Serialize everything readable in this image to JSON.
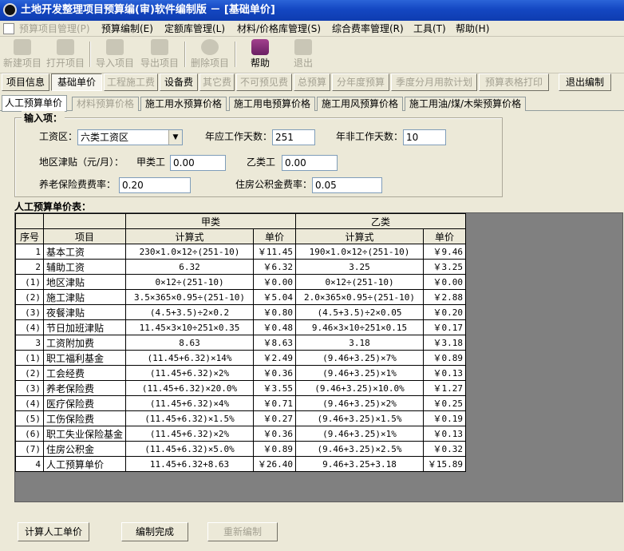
{
  "window": {
    "title": "土地开发整理项目预算编(审)软件编制版 － [基础单价]"
  },
  "menu": [
    {
      "label": "预算项目管理(P)",
      "disabled": true
    },
    {
      "label": "预算编制(E)"
    },
    {
      "label": "定额库管理(L)"
    },
    {
      "label": "材料/价格库管理(S)"
    },
    {
      "label": "综合费率管理(R)"
    },
    {
      "label": "工具(T)"
    },
    {
      "label": "帮助(H)"
    }
  ],
  "toolbar": [
    {
      "label": "新建项目",
      "icon": "new-project-icon",
      "enabled": false
    },
    {
      "label": "打开项目",
      "icon": "open-folder-icon",
      "enabled": false
    },
    {
      "label": "导入项目",
      "icon": "import-icon",
      "enabled": false
    },
    {
      "label": "导出项目",
      "icon": "export-icon",
      "enabled": false
    },
    {
      "label": "删除项目",
      "icon": "delete-icon",
      "enabled": false
    },
    {
      "label": "帮助",
      "icon": "help-book-icon",
      "enabled": true
    },
    {
      "label": "退出",
      "icon": "exit-icon",
      "enabled": false
    }
  ],
  "modules": [
    {
      "label": "项目信息",
      "enabled": true
    },
    {
      "label": "基础单价",
      "enabled": true,
      "selected": true
    },
    {
      "label": "工程施工费",
      "enabled": false
    },
    {
      "label": "设备费",
      "enabled": true
    },
    {
      "label": "其它费",
      "enabled": false
    },
    {
      "label": "不可预见费",
      "enabled": false
    },
    {
      "label": "总预算",
      "enabled": false
    },
    {
      "label": "分年度预算",
      "enabled": false
    },
    {
      "label": "季度分月用款计划",
      "enabled": false
    },
    {
      "label": "预算表格打印",
      "enabled": false
    },
    {
      "label": "退出编制",
      "enabled": true
    }
  ],
  "tabs": [
    {
      "label": "人工预算单价",
      "selected": true
    },
    {
      "label": "材料预算价格",
      "disabled": true
    },
    {
      "label": "施工用水预算价格"
    },
    {
      "label": "施工用电预算价格"
    },
    {
      "label": "施工用风预算价格"
    },
    {
      "label": "施工用油/煤/木柴预算价格"
    }
  ],
  "input": {
    "title": "输入项：",
    "wage_zone_label": "工资区：",
    "wage_zone_value": "六类工资区",
    "annual_days_label": "年应工作天数：",
    "annual_days_value": "251",
    "non_work_days_label": "年非工作天数：",
    "non_work_days_value": "10",
    "area_allowance_label": "地区津贴（元/月）：",
    "class_a_label": "甲类工",
    "class_a_value": "0.00",
    "class_b_label": "乙类工",
    "class_b_value": "0.00",
    "pension_label": "养老保险费费率：",
    "pension_value": "0.20",
    "housing_label": "住房公积金费率：",
    "housing_value": "0.05"
  },
  "table": {
    "title": "人工预算单价表：",
    "group_a": "甲类",
    "group_b": "乙类",
    "col_no": "序号",
    "col_item": "项目",
    "col_formula": "计算式",
    "col_price": "单价",
    "rows": [
      {
        "no": "1",
        "item": "基本工资",
        "fa": "230×1.0×12÷(251-10)",
        "pa": "￥11.45",
        "fb": "190×1.0×12÷(251-10)",
        "pb": "￥9.46"
      },
      {
        "no": "2",
        "item": "辅助工资",
        "fa": "6.32",
        "pa": "￥6.32",
        "fb": "3.25",
        "pb": "￥3.25"
      },
      {
        "no": "(1)",
        "item": "地区津贴",
        "fa": "0×12÷(251-10)",
        "pa": "￥0.00",
        "fb": "0×12÷(251-10)",
        "pb": "￥0.00"
      },
      {
        "no": "(2)",
        "item": "施工津贴",
        "fa": "3.5×365×0.95÷(251-10)",
        "pa": "￥5.04",
        "fb": "2.0×365×0.95÷(251-10)",
        "pb": "￥2.88"
      },
      {
        "no": "(3)",
        "item": "夜餐津贴",
        "fa": "(4.5+3.5)÷2×0.2",
        "pa": "￥0.80",
        "fb": "(4.5+3.5)÷2×0.05",
        "pb": "￥0.20"
      },
      {
        "no": "(4)",
        "item": "节日加班津贴",
        "fa": "11.45×3×10÷251×0.35",
        "pa": "￥0.48",
        "fb": "9.46×3×10÷251×0.15",
        "pb": "￥0.17"
      },
      {
        "no": "3",
        "item": "工资附加费",
        "fa": "8.63",
        "pa": "￥8.63",
        "fb": "3.18",
        "pb": "￥3.18"
      },
      {
        "no": "(1)",
        "item": "职工福利基金",
        "fa": "(11.45+6.32)×14%",
        "pa": "￥2.49",
        "fb": "(9.46+3.25)×7%",
        "pb": "￥0.89"
      },
      {
        "no": "(2)",
        "item": "工会经费",
        "fa": "(11.45+6.32)×2%",
        "pa": "￥0.36",
        "fb": "(9.46+3.25)×1%",
        "pb": "￥0.13"
      },
      {
        "no": "(3)",
        "item": "养老保险费",
        "fa": "(11.45+6.32)×20.0%",
        "pa": "￥3.55",
        "fb": "(9.46+3.25)×10.0%",
        "pb": "￥1.27"
      },
      {
        "no": "(4)",
        "item": "医疗保险费",
        "fa": "(11.45+6.32)×4%",
        "pa": "￥0.71",
        "fb": "(9.46+3.25)×2%",
        "pb": "￥0.25"
      },
      {
        "no": "(5)",
        "item": "工伤保险费",
        "fa": "(11.45+6.32)×1.5%",
        "pa": "￥0.27",
        "fb": "(9.46+3.25)×1.5%",
        "pb": "￥0.19"
      },
      {
        "no": "(6)",
        "item": "职工失业保险基金",
        "fa": "(11.45+6.32)×2%",
        "pa": "￥0.36",
        "fb": "(9.46+3.25)×1%",
        "pb": "￥0.13"
      },
      {
        "no": "(7)",
        "item": "住房公积金",
        "fa": "(11.45+6.32)×5.0%",
        "pa": "￥0.89",
        "fb": "(9.46+3.25)×2.5%",
        "pb": "￥0.32"
      },
      {
        "no": "4",
        "item": "人工预算单价",
        "fa": "11.45+6.32+8.63",
        "pa": "￥26.40",
        "fb": "9.46+3.25+3.18",
        "pb": "￥15.89"
      }
    ]
  },
  "buttons": {
    "calc": "计算人工单价",
    "done": "编制完成",
    "reedit": "重新编制"
  }
}
